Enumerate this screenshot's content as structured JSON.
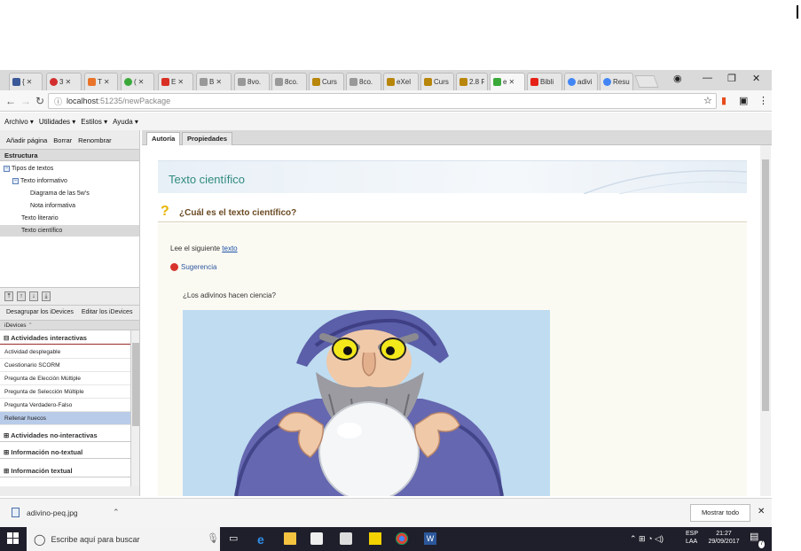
{
  "browser": {
    "tabs": [
      {
        "title": "{",
        "color": "#3b5998"
      },
      {
        "title": "3",
        "color": "#d32e2e"
      },
      {
        "title": "T",
        "color": "#e8742a"
      },
      {
        "title": "(",
        "color": "#3aa93a"
      },
      {
        "title": "E",
        "color": "#d93025"
      },
      {
        "title": "B",
        "color": "#666666"
      },
      {
        "title": "8vo.",
        "color": "#666666"
      },
      {
        "title": "8co.",
        "color": "#666666"
      },
      {
        "title": "Curs",
        "color": "#b8860b"
      },
      {
        "title": "8co.",
        "color": "#666666"
      },
      {
        "title": "eXel",
        "color": "#b8860b"
      },
      {
        "title": "Curs",
        "color": "#b8860b"
      },
      {
        "title": "2.8 F",
        "color": "#b8860b"
      },
      {
        "title": "e",
        "color": "#3aa93a"
      },
      {
        "title": "Bibli",
        "color": "#e62117"
      },
      {
        "title": "adivi",
        "color": "#4285f4"
      },
      {
        "title": "Resu",
        "color": "#4285f4"
      }
    ],
    "url_host": "localhost",
    "url_port_path": ":51235/newPackage"
  },
  "menu": [
    "Archivo ▾",
    "Utilidades ▾",
    "Estilos ▾",
    "Ayuda ▾"
  ],
  "left": {
    "buttons": [
      "Añadir página",
      "Borrar",
      "Renombrar"
    ],
    "structure_title": "Estructura",
    "tree": [
      "Tipos de textos",
      "Texto informativo",
      "Diagrama de las 5w's",
      "Nota informativa",
      "Texto literario",
      "Texto científico"
    ],
    "idevice_tabs": [
      "Desagrupar los iDevices",
      "Editar los iDevices"
    ],
    "idevices_head": "iDevices",
    "categories": [
      "Actividades interactivas",
      "Actividades no-interactivas",
      "Información no-textual",
      "Información textual"
    ],
    "idevices": [
      "Actividad desplegable",
      "Cuestionario SCORM",
      "Pregunta de Elección Múltiple",
      "Pregunta de Selección Múltiple",
      "Pregunta Verdadero-Falso",
      "Rellenar huecos"
    ]
  },
  "main": {
    "tabs": [
      "Autoría",
      "Propiedades"
    ],
    "page_title": "Texto científico",
    "question": "¿Cuál es el texto científico?",
    "lead": "Lee el siguiente ",
    "lead_link": "texto",
    "hint": "Sugerencia",
    "image_caption": "¿Los adivinos hacen ciencia?"
  },
  "download": {
    "file": "adivino-peq.jpg",
    "show_all": "Mostrar todo"
  },
  "taskbar": {
    "search_placeholder": "Escribe aquí para buscar",
    "lang": "ESP",
    "layout": "LAA",
    "time": "21:27",
    "date": "29/09/2017",
    "notif_count": "7"
  },
  "colors": {
    "accent_teal": "#2f8a7f",
    "question_brown": "#6a4a22",
    "selection_blue": "#b8cbe8"
  }
}
